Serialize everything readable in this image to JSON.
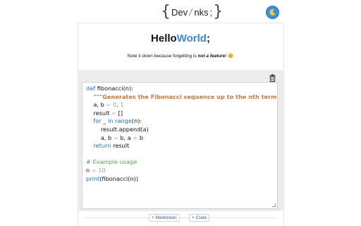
{
  "header": {
    "logo_left": "Dev",
    "logo_right": "nks",
    "logo_mark": "/",
    "logo_sep": ";",
    "theme_toggle_icon": "moon-icon"
  },
  "title": {
    "part1": "Hello",
    "part2": "World",
    "part3": ";"
  },
  "tagline": {
    "before": "Note it down because forgetting is ",
    "emphasis": "not a feature",
    "after": "! 😊"
  },
  "editor": {
    "language": "python",
    "delete_icon": "trash-icon"
  },
  "buttons": {
    "markdown": "+ Markdown",
    "code": "+ Code"
  },
  "colors": {
    "accent": "#3b8bd6",
    "keyword": "#1e6fc8",
    "string": "#c17a3f",
    "comment": "#5f9d59",
    "number": "#8fb07a"
  }
}
